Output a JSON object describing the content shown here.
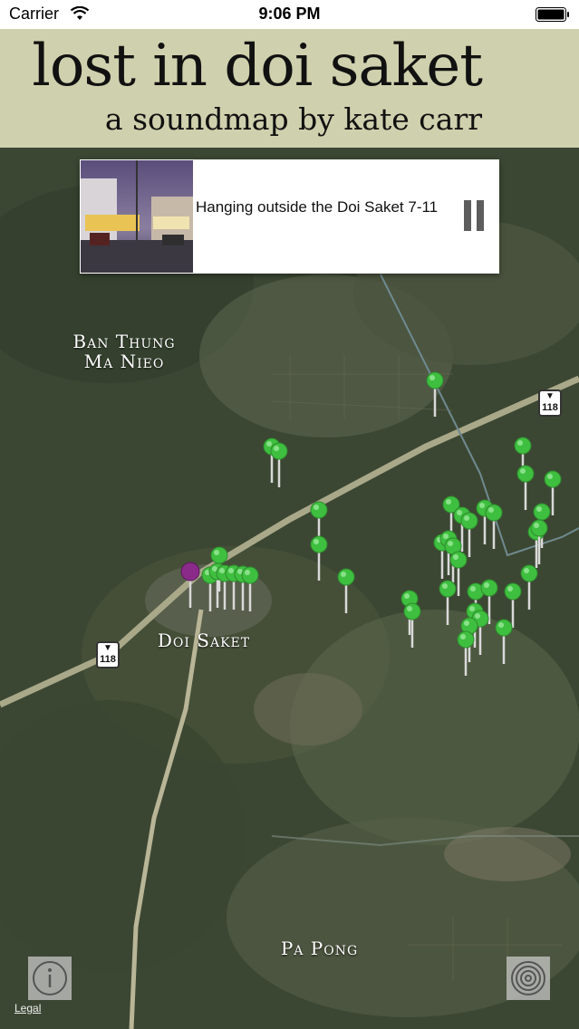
{
  "status_bar": {
    "carrier": "Carrier",
    "time": "9:06 PM"
  },
  "header": {
    "title": "lost in doi saket",
    "subtitle": "a soundmap by kate carr"
  },
  "now_playing": {
    "track_title": "Hanging outside the Doi Saket 7-11",
    "thumbnail_icon": "street-photo"
  },
  "map": {
    "labels": {
      "ban_thung_line1": "Ban Thung",
      "ban_thung_line2": "Ma Nieo",
      "doi_saket": "Doi Saket",
      "pa_pong": "Pa Pong"
    },
    "route_shields": [
      "118",
      "118"
    ],
    "pin_colors": {
      "sound": "#3fbf3f",
      "current": "#8a2b8a"
    },
    "legal": "Legal"
  },
  "controls": {
    "info_icon": "info-icon",
    "radar_icon": "radar-icon"
  }
}
